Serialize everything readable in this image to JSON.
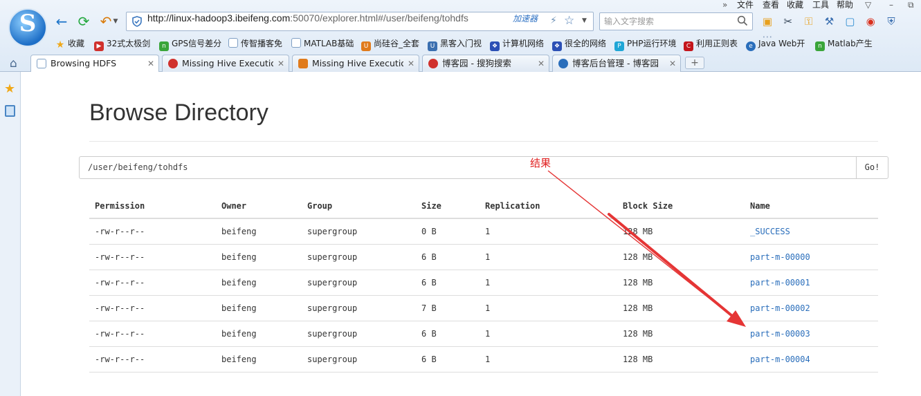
{
  "browser": {
    "url_host": "http://linux-hadoop3.ibeifeng.com",
    "url_rest": ":50070/explorer.html#/user/beifeng/tohdfs",
    "accelerator_label": "加速器",
    "search_placeholder": "输入文字搜索",
    "menu": [
      "文件",
      "查看",
      "收藏",
      "工具",
      "帮助"
    ],
    "menu_more": "»",
    "bookmarks": [
      {
        "label": "收藏",
        "icon": "star-icon",
        "color": "#f0a818"
      },
      {
        "label": "32式太极剑",
        "icon": "play-icon",
        "color": "#d0312d"
      },
      {
        "label": "GPS信号差分",
        "icon": "leaf-icon",
        "color": "#3aa53a"
      },
      {
        "label": "传智播客免",
        "icon": "page-icon",
        "color": "#7f9fc4"
      },
      {
        "label": "MATLAB基础",
        "icon": "page-icon",
        "color": "#7f9fc4"
      },
      {
        "label": "尚硅谷_全套",
        "icon": "u-icon",
        "color": "#e07b1c"
      },
      {
        "label": "黑客入门视",
        "icon": "u-icon",
        "color": "#e07b1c"
      },
      {
        "label": "计算机网络",
        "icon": "paw-icon",
        "color": "#2b4fb5"
      },
      {
        "label": "很全的网络",
        "icon": "paw-icon",
        "color": "#2b4fb5"
      },
      {
        "label": "PHP运行环境",
        "icon": "php-icon",
        "color": "#1fa6d6"
      },
      {
        "label": "利用正则表",
        "icon": "c-icon",
        "color": "#c4161c"
      },
      {
        "label": "Java Web开",
        "icon": "globe-icon",
        "color": "#2a6ebb"
      },
      {
        "label": "Matlab产生",
        "icon": "leaf-icon",
        "color": "#3aa53a"
      }
    ],
    "tabs": [
      {
        "label": "Browsing HDFS",
        "active": true,
        "color": "#7f9fc4"
      },
      {
        "label": "Missing Hive Execution",
        "active": false,
        "color": "#d0312d"
      },
      {
        "label": "Missing Hive Execution",
        "active": false,
        "color": "#e07b1c"
      },
      {
        "label": "博客园 - 搜狗搜索",
        "active": false,
        "color": "#d0312d"
      },
      {
        "label": "博客后台管理 - 博客园",
        "active": false,
        "color": "#2a6ebb"
      }
    ],
    "new_tab_label": "+"
  },
  "page": {
    "title": "Browse Directory",
    "path_value": "/user/beifeng/tohdfs",
    "go_label": "Go!",
    "columns": [
      "Permission",
      "Owner",
      "Group",
      "Size",
      "Replication",
      "Block Size",
      "Name"
    ],
    "rows": [
      [
        "-rw-r--r--",
        "beifeng",
        "supergroup",
        "0 B",
        "1",
        "128 MB",
        "_SUCCESS"
      ],
      [
        "-rw-r--r--",
        "beifeng",
        "supergroup",
        "6 B",
        "1",
        "128 MB",
        "part-m-00000"
      ],
      [
        "-rw-r--r--",
        "beifeng",
        "supergroup",
        "6 B",
        "1",
        "128 MB",
        "part-m-00001"
      ],
      [
        "-rw-r--r--",
        "beifeng",
        "supergroup",
        "7 B",
        "1",
        "128 MB",
        "part-m-00002"
      ],
      [
        "-rw-r--r--",
        "beifeng",
        "supergroup",
        "6 B",
        "1",
        "128 MB",
        "part-m-00003"
      ],
      [
        "-rw-r--r--",
        "beifeng",
        "supergroup",
        "6 B",
        "1",
        "128 MB",
        "part-m-00004"
      ]
    ],
    "annotation": "结果",
    "annotation_color": "#e02020",
    "link_color": "#2a6ebb"
  }
}
